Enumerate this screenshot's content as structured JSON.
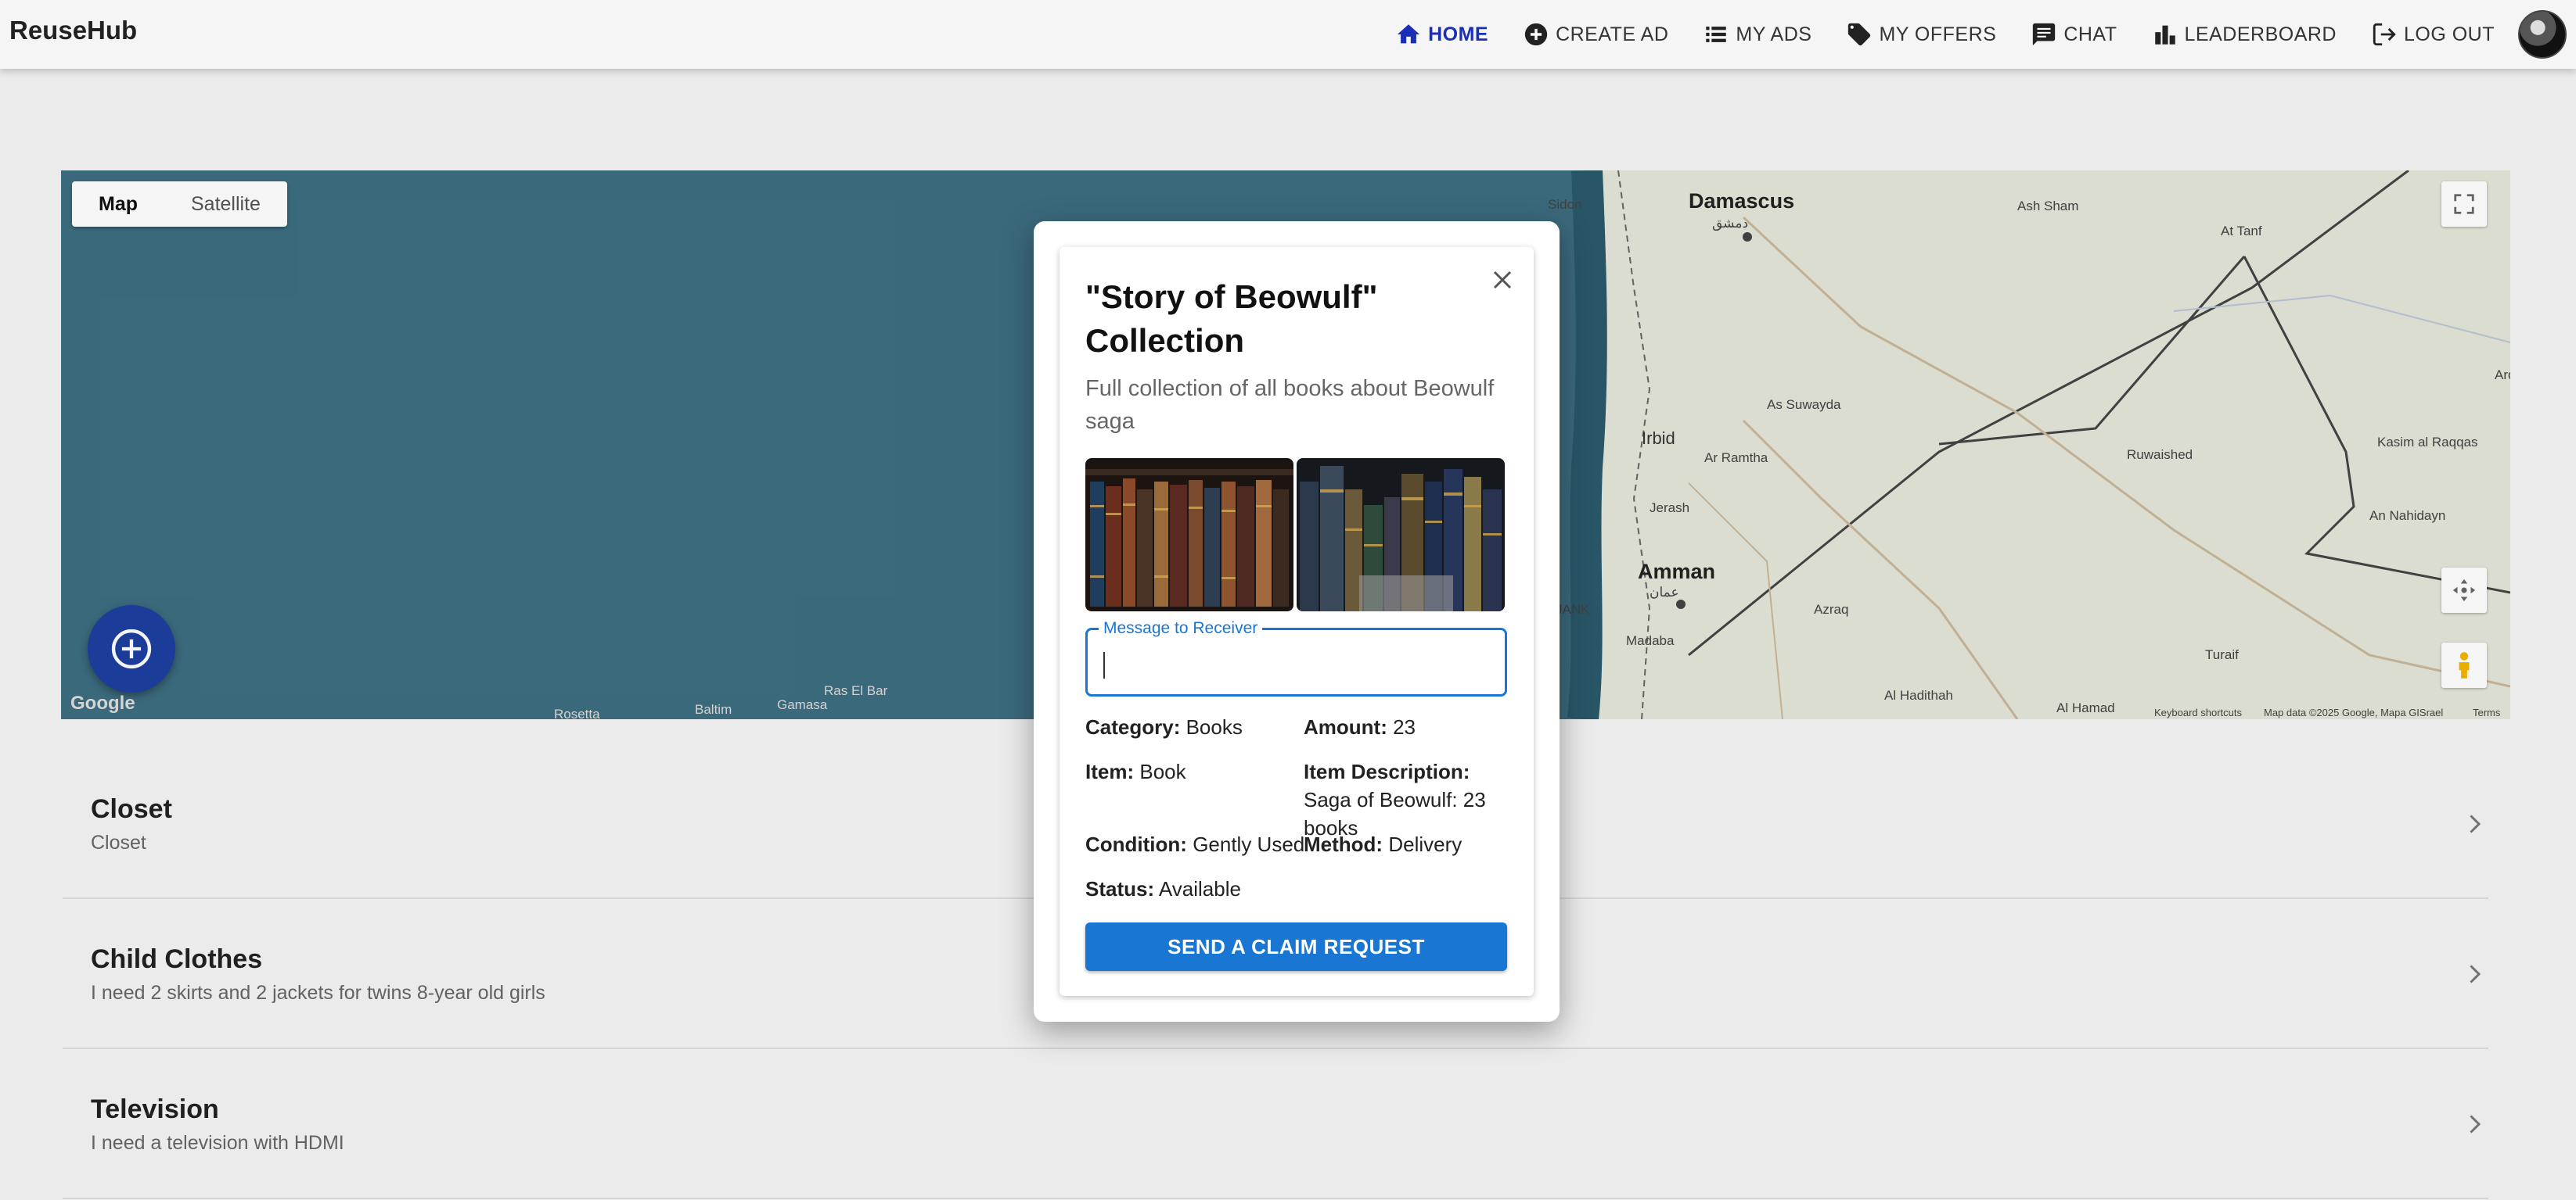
{
  "app": {
    "brand": "ReuseHub"
  },
  "nav": {
    "home": "HOME",
    "create_ad": "CREATE AD",
    "my_ads": "MY ADS",
    "my_offers": "MY OFFERS",
    "chat": "CHAT",
    "leaderboard": "LEADERBOARD",
    "logout": "LOG OUT"
  },
  "map": {
    "type_map": "Map",
    "type_satellite": "Satellite",
    "google": "Google",
    "labels": {
      "damascus": "Damascus",
      "damascus_ar": "دمشق",
      "amman": "Amman",
      "amman_ar": "عمان",
      "irbid": "Irbid",
      "as_suwayda": "As Suwayda",
      "ar_ramtha": "Ar Ramtha",
      "jerash": "Jerash",
      "madaba": "Madaba",
      "azraq": "Azraq",
      "ruwaished": "Ruwaished",
      "an_nahidayn": "An Nahidayn",
      "kasim": "Kasim al Raqqas",
      "ardan": "Ardan",
      "turaif": "Turaif",
      "al_hadithah": "Al Hadithah",
      "al_hamad": "Al Hamad",
      "at_tanf": "At Tanf",
      "ash_sham": "Ash Sham",
      "rosetta": "Rosetta",
      "baltim": "Baltim",
      "gamasa": "Gamasa",
      "ras_elbar": "Ras El Bar",
      "jank": "JANK",
      "sidon": "Sidon",
      "shortcuts": "Keyboard shortcuts",
      "mapdata": "Map data ©2025 Google, Mapa GISrael",
      "terms": "Terms"
    }
  },
  "list": [
    {
      "title": "Closet",
      "subtitle": "Closet"
    },
    {
      "title": "Child Clothes",
      "subtitle": "I need 2 skirts and 2 jackets for twins 8-year old girls"
    },
    {
      "title": "Television",
      "subtitle": "I need a television with HDMI"
    }
  ],
  "dialog": {
    "title": "\"Story of Beowulf\" Collection",
    "description": "Full collection of all books about Beowulf saga",
    "message_label": "Message to Receiver",
    "message_value": "",
    "category_label": "Category:",
    "category": "Books",
    "amount_label": "Amount:",
    "amount": "23",
    "item_label": "Item:",
    "item": "Book",
    "item_desc_label": "Item Description:",
    "item_desc": "Saga of Beowulf: 23 books",
    "condition_label": "Condition:",
    "condition": "Gently Used",
    "method_label": "Method:",
    "method": "Delivery",
    "status_label": "Status:",
    "status": "Available",
    "submit": "SEND A CLAIM REQUEST"
  },
  "colors": {
    "primary": "#1976d2",
    "nav_active": "#1a2fb5",
    "fab": "#1d3fa0",
    "sea": "#3d6e80"
  }
}
